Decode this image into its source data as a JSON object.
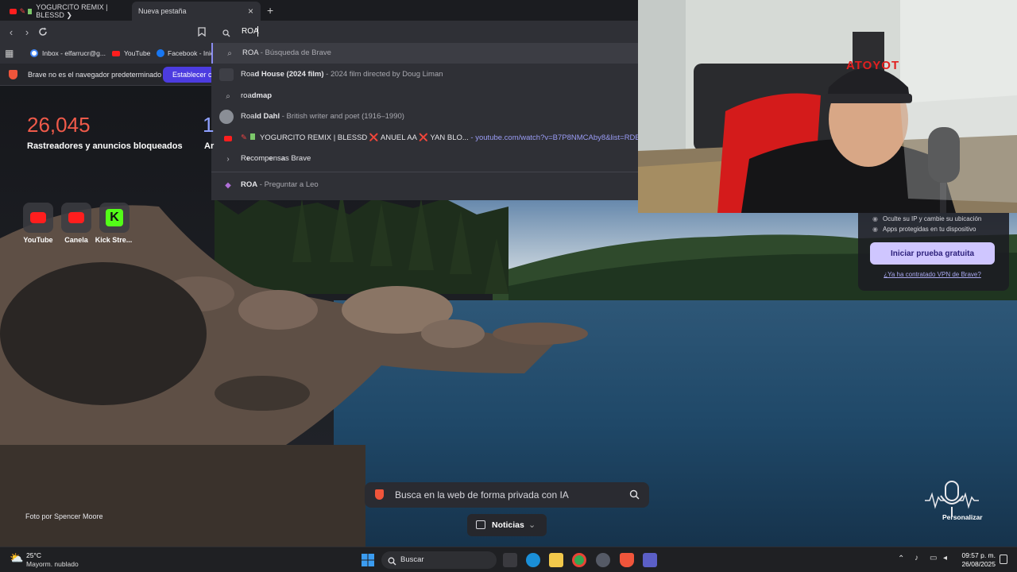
{
  "tabs": [
    {
      "label": "YOGURCITO REMIX | BLESSD ❯",
      "active": false
    },
    {
      "label": "Nueva pestaña",
      "active": true
    }
  ],
  "tab_close": "×",
  "new_tab": "+",
  "omnibox": {
    "value": "ROA"
  },
  "bookmarks": [
    {
      "label": "Inbox - elfarrucr@g...",
      "icon": "google-icon"
    },
    {
      "label": "YouTube",
      "icon": "youtube-icon"
    },
    {
      "label": "Facebook - Inic",
      "icon": "facebook-icon"
    }
  ],
  "infobar": {
    "text": "Brave no es el navegador predeterminado",
    "button": "Establecer co"
  },
  "suggestions": [
    {
      "bold": "ROA",
      "sub": " - Búsqueda de Brave",
      "icon": "search-icon"
    },
    {
      "pre": "Roa",
      "bold": "d House (2024 film)",
      "sub": " - 2024 film directed by Doug Liman",
      "icon": "thumbnail-icon"
    },
    {
      "pre": "roa",
      "bold": "dmap",
      "sub": "",
      "icon": "search-icon"
    },
    {
      "pre": "Roa",
      "bold": "ld Dahl",
      "sub": " - British writer and poet (1916–1990)",
      "icon": "portrait-icon"
    },
    {
      "pre": "",
      "bold": "",
      "main": "YOGURCITO REMIX | BLESSD ❌ ANUEL AA ❌ YAN BLO...",
      "link": " - youtube.com/watch?v=B7P8NMCAby8&list=RDB7P8",
      "icon": "youtube-icon"
    },
    {
      "pre": "R",
      "bold": "e",
      "rest": "comp",
      "bold2": "e",
      "rest2": "ns",
      "bold3": "a",
      "rest3": "s Brave",
      "icon": "chevron-right-icon"
    },
    {
      "bold": "ROA",
      "sub": " - Preguntar a Leo",
      "icon": "leo-icon"
    }
  ],
  "stats": {
    "count": "26,045",
    "label": "Rastreadores y anuncios bloqueados",
    "count2": "1",
    "label2": "Ar"
  },
  "shortcuts": [
    {
      "label": "YouTube",
      "icon": "youtube-icon"
    },
    {
      "label": "Canela",
      "icon": "youtube-icon"
    },
    {
      "label": "Kick Stre...",
      "icon": "kick-icon"
    }
  ],
  "vpn": {
    "items": [
      "Oculte su IP y cambie su ubicación",
      "Apps protegidas en tu dispositivo"
    ],
    "button": "Iniciar prueba gratuita",
    "link": "¿Ya ha contratado VPN de Brave?"
  },
  "search": {
    "placeholder": "Busca en la web de forma privada con IA"
  },
  "news": {
    "label": "Noticias"
  },
  "photo_credit": "Foto por Spencer Moore",
  "customize": "Personalizar",
  "cam_sign": "ATOYOT",
  "taskbar": {
    "weather_temp": "25°C",
    "weather_desc": "Mayorm. nublado",
    "search_label": "Buscar",
    "time": "09:57 p. m.",
    "date": "26/08/2025"
  },
  "colors": {
    "accent": "#4c3ce0",
    "stat_red": "#f05a4a",
    "vpn_button": "#cfc6ff"
  }
}
